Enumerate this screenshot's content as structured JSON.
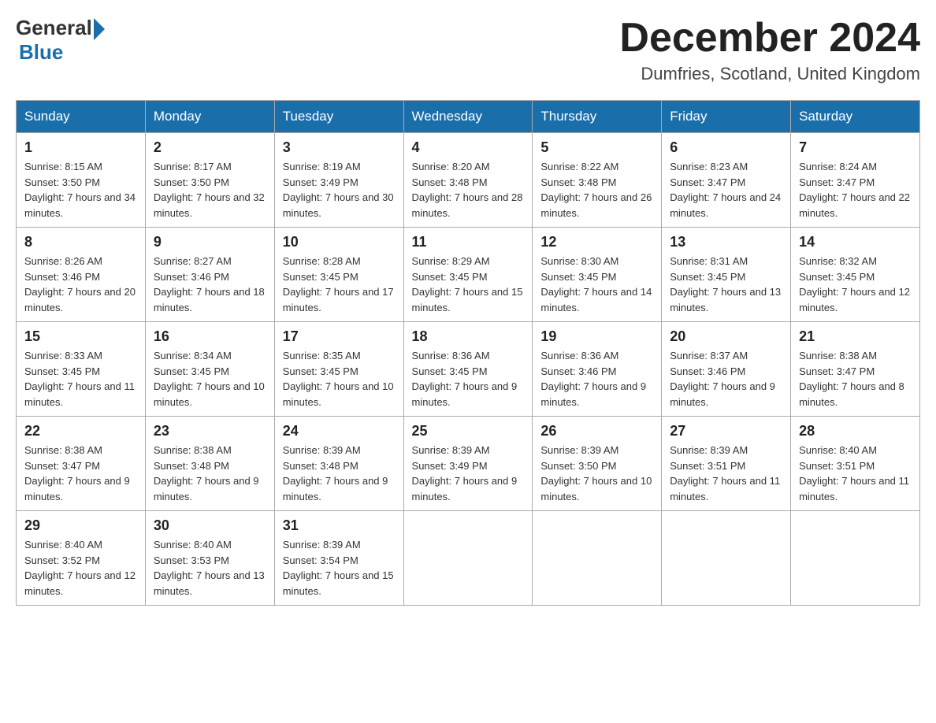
{
  "logo": {
    "general": "General",
    "blue": "Blue"
  },
  "title": "December 2024",
  "location": "Dumfries, Scotland, United Kingdom",
  "days_of_week": [
    "Sunday",
    "Monday",
    "Tuesday",
    "Wednesday",
    "Thursday",
    "Friday",
    "Saturday"
  ],
  "weeks": [
    [
      {
        "day": "1",
        "sunrise": "8:15 AM",
        "sunset": "3:50 PM",
        "daylight": "7 hours and 34 minutes."
      },
      {
        "day": "2",
        "sunrise": "8:17 AM",
        "sunset": "3:50 PM",
        "daylight": "7 hours and 32 minutes."
      },
      {
        "day": "3",
        "sunrise": "8:19 AM",
        "sunset": "3:49 PM",
        "daylight": "7 hours and 30 minutes."
      },
      {
        "day": "4",
        "sunrise": "8:20 AM",
        "sunset": "3:48 PM",
        "daylight": "7 hours and 28 minutes."
      },
      {
        "day": "5",
        "sunrise": "8:22 AM",
        "sunset": "3:48 PM",
        "daylight": "7 hours and 26 minutes."
      },
      {
        "day": "6",
        "sunrise": "8:23 AM",
        "sunset": "3:47 PM",
        "daylight": "7 hours and 24 minutes."
      },
      {
        "day": "7",
        "sunrise": "8:24 AM",
        "sunset": "3:47 PM",
        "daylight": "7 hours and 22 minutes."
      }
    ],
    [
      {
        "day": "8",
        "sunrise": "8:26 AM",
        "sunset": "3:46 PM",
        "daylight": "7 hours and 20 minutes."
      },
      {
        "day": "9",
        "sunrise": "8:27 AM",
        "sunset": "3:46 PM",
        "daylight": "7 hours and 18 minutes."
      },
      {
        "day": "10",
        "sunrise": "8:28 AM",
        "sunset": "3:45 PM",
        "daylight": "7 hours and 17 minutes."
      },
      {
        "day": "11",
        "sunrise": "8:29 AM",
        "sunset": "3:45 PM",
        "daylight": "7 hours and 15 minutes."
      },
      {
        "day": "12",
        "sunrise": "8:30 AM",
        "sunset": "3:45 PM",
        "daylight": "7 hours and 14 minutes."
      },
      {
        "day": "13",
        "sunrise": "8:31 AM",
        "sunset": "3:45 PM",
        "daylight": "7 hours and 13 minutes."
      },
      {
        "day": "14",
        "sunrise": "8:32 AM",
        "sunset": "3:45 PM",
        "daylight": "7 hours and 12 minutes."
      }
    ],
    [
      {
        "day": "15",
        "sunrise": "8:33 AM",
        "sunset": "3:45 PM",
        "daylight": "7 hours and 11 minutes."
      },
      {
        "day": "16",
        "sunrise": "8:34 AM",
        "sunset": "3:45 PM",
        "daylight": "7 hours and 10 minutes."
      },
      {
        "day": "17",
        "sunrise": "8:35 AM",
        "sunset": "3:45 PM",
        "daylight": "7 hours and 10 minutes."
      },
      {
        "day": "18",
        "sunrise": "8:36 AM",
        "sunset": "3:45 PM",
        "daylight": "7 hours and 9 minutes."
      },
      {
        "day": "19",
        "sunrise": "8:36 AM",
        "sunset": "3:46 PM",
        "daylight": "7 hours and 9 minutes."
      },
      {
        "day": "20",
        "sunrise": "8:37 AM",
        "sunset": "3:46 PM",
        "daylight": "7 hours and 9 minutes."
      },
      {
        "day": "21",
        "sunrise": "8:38 AM",
        "sunset": "3:47 PM",
        "daylight": "7 hours and 8 minutes."
      }
    ],
    [
      {
        "day": "22",
        "sunrise": "8:38 AM",
        "sunset": "3:47 PM",
        "daylight": "7 hours and 9 minutes."
      },
      {
        "day": "23",
        "sunrise": "8:38 AM",
        "sunset": "3:48 PM",
        "daylight": "7 hours and 9 minutes."
      },
      {
        "day": "24",
        "sunrise": "8:39 AM",
        "sunset": "3:48 PM",
        "daylight": "7 hours and 9 minutes."
      },
      {
        "day": "25",
        "sunrise": "8:39 AM",
        "sunset": "3:49 PM",
        "daylight": "7 hours and 9 minutes."
      },
      {
        "day": "26",
        "sunrise": "8:39 AM",
        "sunset": "3:50 PM",
        "daylight": "7 hours and 10 minutes."
      },
      {
        "day": "27",
        "sunrise": "8:39 AM",
        "sunset": "3:51 PM",
        "daylight": "7 hours and 11 minutes."
      },
      {
        "day": "28",
        "sunrise": "8:40 AM",
        "sunset": "3:51 PM",
        "daylight": "7 hours and 11 minutes."
      }
    ],
    [
      {
        "day": "29",
        "sunrise": "8:40 AM",
        "sunset": "3:52 PM",
        "daylight": "7 hours and 12 minutes."
      },
      {
        "day": "30",
        "sunrise": "8:40 AM",
        "sunset": "3:53 PM",
        "daylight": "7 hours and 13 minutes."
      },
      {
        "day": "31",
        "sunrise": "8:39 AM",
        "sunset": "3:54 PM",
        "daylight": "7 hours and 15 minutes."
      },
      null,
      null,
      null,
      null
    ]
  ]
}
